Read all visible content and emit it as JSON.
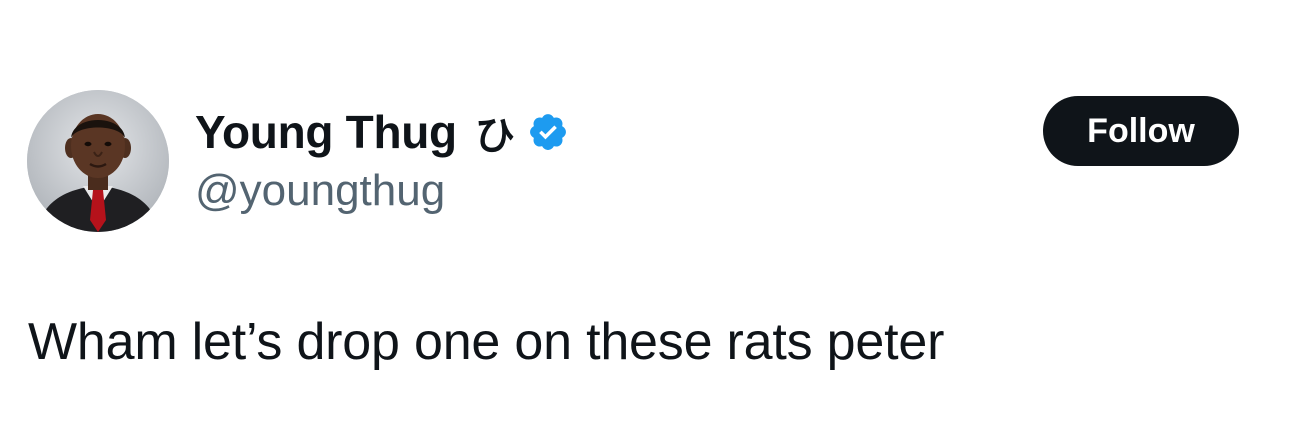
{
  "author": {
    "display_name": "Young Thug",
    "name_glyph": "ひ",
    "handle": "@youngthug",
    "verified": true,
    "avatar_icon": "profile-photo"
  },
  "follow_button": {
    "label": "Follow"
  },
  "tweet": {
    "text": "Wham let’s drop one on these rats peter"
  },
  "colors": {
    "text_primary": "#0f1419",
    "text_secondary": "#536471",
    "verified_blue": "#1d9bf0",
    "button_bg": "#0f1419",
    "button_text": "#ffffff",
    "background": "#ffffff"
  }
}
